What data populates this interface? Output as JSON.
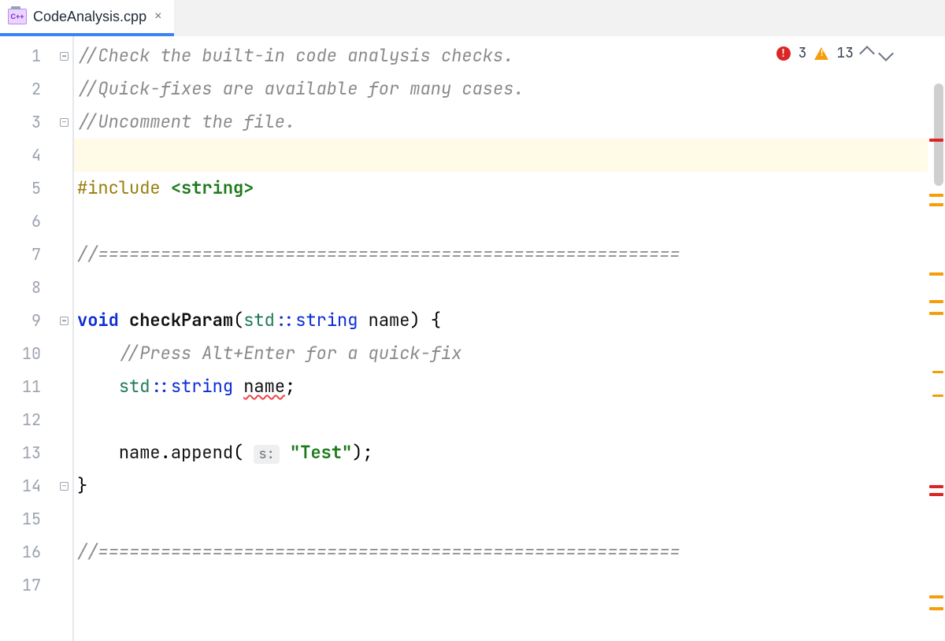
{
  "tab": {
    "icon_text": "C++",
    "filename": "CodeAnalysis.cpp",
    "close_glyph": "×"
  },
  "inspections": {
    "error_count": "3",
    "warning_count": "13"
  },
  "gutter": {
    "line_numbers": [
      "1",
      "2",
      "3",
      "4",
      "5",
      "6",
      "7",
      "8",
      "9",
      "10",
      "11",
      "12",
      "13",
      "14",
      "15",
      "16",
      "17"
    ]
  },
  "code": {
    "l1_comment": "//Check the built-in code analysis checks.",
    "l2_comment": "//Quick-fixes are available for many cases.",
    "l3_comment": "//Uncomment the file.",
    "l5_pre": "#include ",
    "l5_inc": "<string>",
    "l7_sep": "//========================================================",
    "l9_kw_void": "void",
    "l9_fn": "checkParam",
    "l9_ns": "std",
    "l9_type": "string",
    "l9_param": "name",
    "l10_comment": "//Press Alt+Enter for a quick-fix",
    "l11_ns": "std",
    "l11_type": "string",
    "l11_var": "name",
    "l13_obj": "name",
    "l13_method": "append",
    "l13_hint": "s:",
    "l13_str": "\"Test\"",
    "l16_sep": "//========================================================"
  }
}
